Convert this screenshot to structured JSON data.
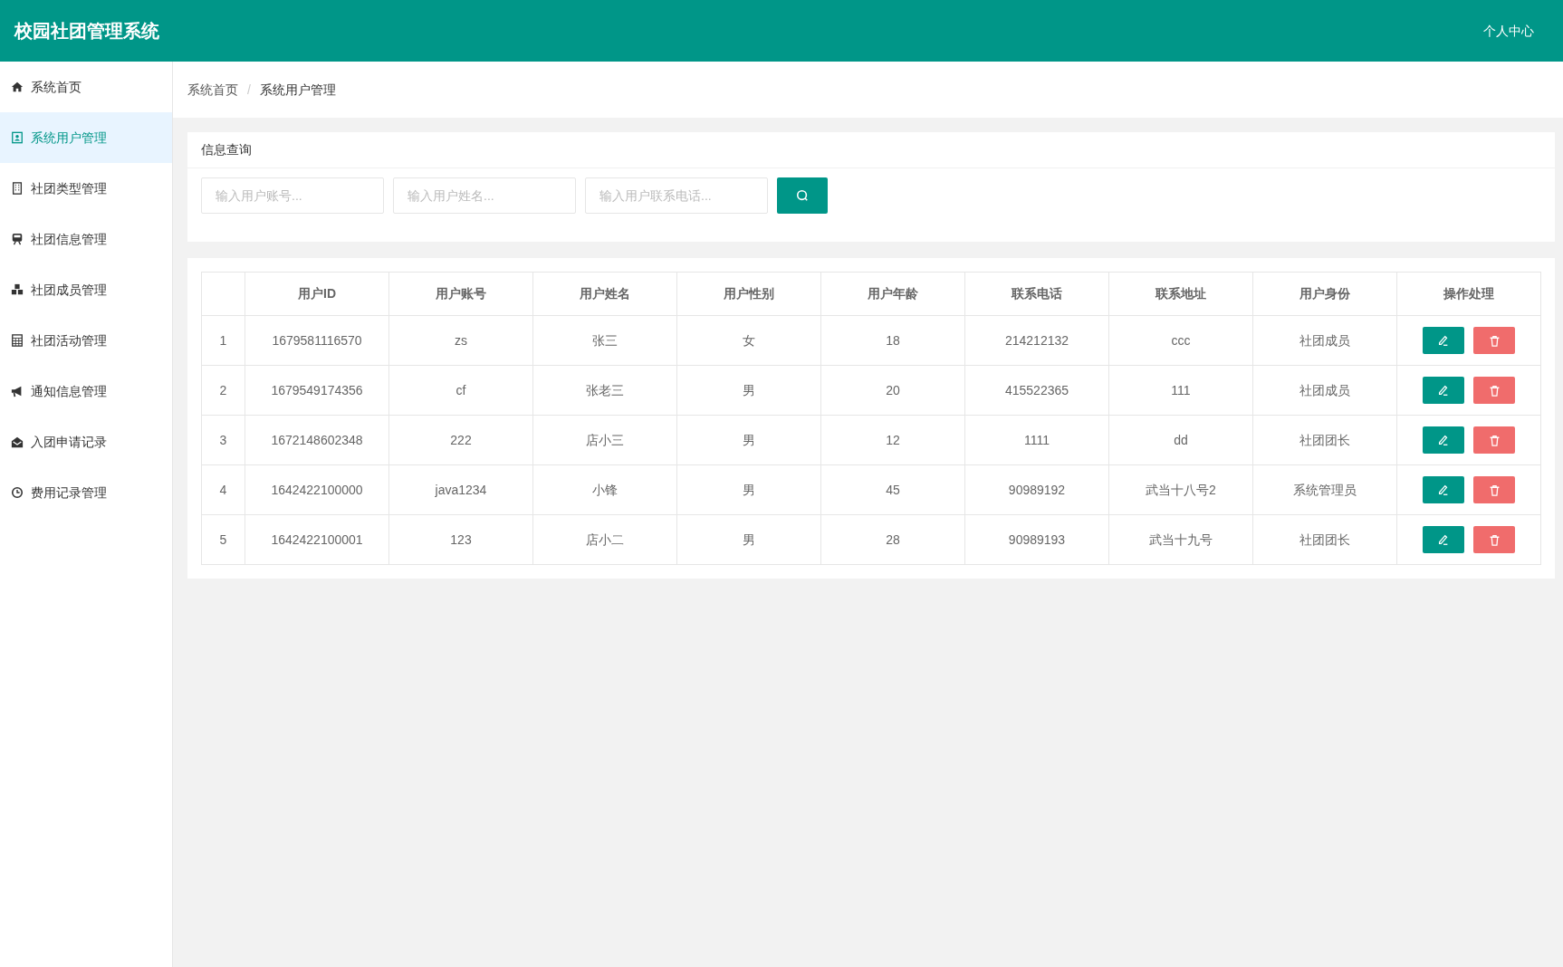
{
  "header": {
    "title": "校园社团管理系统",
    "user_menu": "个人中心"
  },
  "sidebar": {
    "items": [
      {
        "label": "系统首页",
        "selected": false
      },
      {
        "label": "系统用户管理",
        "selected": true
      },
      {
        "label": "社团类型管理",
        "selected": false
      },
      {
        "label": "社团信息管理",
        "selected": false
      },
      {
        "label": "社团成员管理",
        "selected": false
      },
      {
        "label": "社团活动管理",
        "selected": false
      },
      {
        "label": "通知信息管理",
        "selected": false
      },
      {
        "label": "入团申请记录",
        "selected": false
      },
      {
        "label": "费用记录管理",
        "selected": false
      }
    ]
  },
  "breadcrumb": [
    "系统首页",
    "/",
    "系统用户管理"
  ],
  "search": {
    "title": "信息查询",
    "fields": [
      {
        "placeholder": "输入用户账号..."
      },
      {
        "placeholder": "输入用户姓名..."
      },
      {
        "placeholder": "输入用户联系电话..."
      }
    ]
  },
  "table": {
    "columns": [
      "",
      "用户ID",
      "用户账号",
      "用户姓名",
      "用户性别",
      "用户年龄",
      "联系电话",
      "联系地址",
      "用户身份",
      "操作处理"
    ],
    "rows": [
      [
        "1",
        "1679581116570",
        "zs",
        "张三",
        "女",
        "18",
        "214212132",
        "ccc",
        "社团成员"
      ],
      [
        "2",
        "1679549174356",
        "cf",
        "张老三",
        "男",
        "20",
        "415522365",
        "111",
        "社团成员"
      ],
      [
        "3",
        "1672148602348",
        "222",
        "店小三",
        "男",
        "12",
        "1111",
        "dd",
        "社团团长"
      ],
      [
        "4",
        "1642422100000",
        "java1234",
        "小锋",
        "男",
        "45",
        "90989192",
        "武当十八号2",
        "系统管理员"
      ],
      [
        "5",
        "1642422100001",
        "123",
        "店小二",
        "男",
        "28",
        "90989193",
        "武当十九号",
        "社团团长"
      ]
    ]
  }
}
